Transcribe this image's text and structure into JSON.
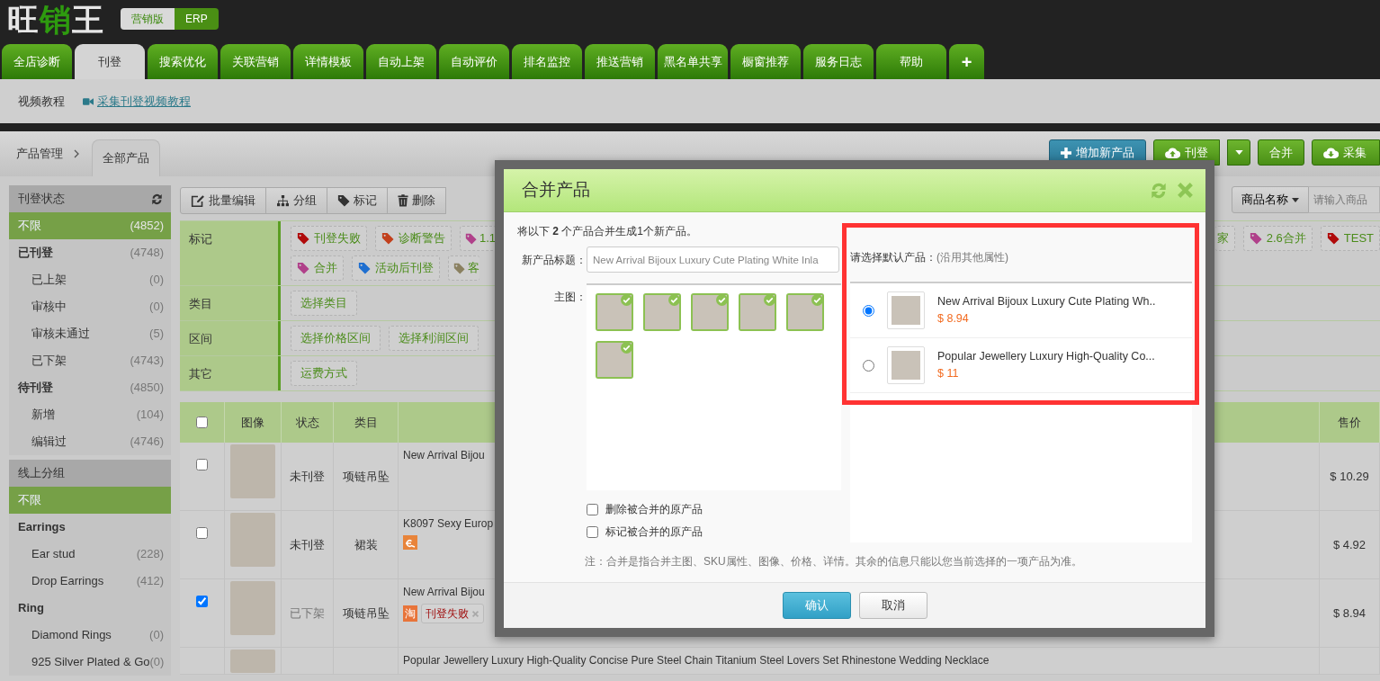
{
  "logo": [
    {
      "text": "旺",
      "color": "#e6e6e6"
    },
    {
      "text": "销",
      "color": "#2e9b0f"
    },
    {
      "text": "王",
      "color": "#e6e6e6"
    }
  ],
  "edition_switch": [
    {
      "label": "营销版",
      "selected": true
    },
    {
      "label": "ERP",
      "selected": false
    }
  ],
  "nav_tabs": [
    {
      "label": "全店诊断",
      "selected": false
    },
    {
      "label": "刊登",
      "selected": true
    },
    {
      "label": "搜索优化",
      "selected": false
    },
    {
      "label": "关联营销",
      "selected": false
    },
    {
      "label": "详情模板",
      "selected": false
    },
    {
      "label": "自动上架",
      "selected": false
    },
    {
      "label": "自动评价",
      "selected": false
    },
    {
      "label": "排名监控",
      "selected": false
    },
    {
      "label": "推送营销",
      "selected": false
    },
    {
      "label": "黑名单共享",
      "selected": false
    },
    {
      "label": "橱窗推荐",
      "selected": false
    },
    {
      "label": "服务日志",
      "selected": false
    },
    {
      "label": "帮助",
      "selected": false
    },
    {
      "label": "+",
      "selected": false
    }
  ],
  "sub_links": [
    {
      "label": "视频教程",
      "kind": "text"
    },
    {
      "label": "采集刊登视频教程",
      "kind": "video"
    }
  ],
  "breadcrumb": {
    "parent": "产品管理",
    "current": "全部产品"
  },
  "action_buttons": [
    {
      "label": "增加新产品",
      "kind": "add"
    },
    {
      "label": "刊登",
      "kind": "upload"
    },
    {
      "label": "合并",
      "kind": "plain"
    },
    {
      "label": "采集",
      "kind": "download"
    }
  ],
  "sidebar": [
    {
      "title": "刊登状态",
      "items": [
        {
          "label": "不限",
          "count": "(4852)",
          "selected": true
        },
        {
          "label": "已刊登",
          "count": "(4748)",
          "selected": false,
          "children": [
            {
              "label": "已上架",
              "count": "(0)",
              "selected": false
            },
            {
              "label": "审核中",
              "count": "(0)",
              "selected": false
            },
            {
              "label": "审核未通过",
              "count": "(5)",
              "selected": false
            },
            {
              "label": "已下架",
              "count": "(4743)",
              "selected": false
            }
          ]
        },
        {
          "label": "待刊登",
          "count": "(4850)",
          "selected": false,
          "children": [
            {
              "label": "新增",
              "count": "(104)",
              "selected": false
            },
            {
              "label": "编辑过",
              "count": "(4746)",
              "selected": false
            }
          ]
        }
      ]
    },
    {
      "title": "线上分组",
      "items": [
        {
          "label": "不限",
          "selected": true
        },
        {
          "label": "Earrings",
          "selected": false,
          "children": [
            {
              "label": "Ear stud",
              "count": "(228)",
              "selected": false
            },
            {
              "label": "Drop Earrings",
              "count": "(412)",
              "selected": false
            }
          ]
        },
        {
          "label": "Ring",
          "selected": false,
          "children": [
            {
              "label": "Diamond Rings",
              "count": "(0)",
              "selected": false
            },
            {
              "label": "925 Silver Plated & Go",
              "count": "(0)",
              "selected": false
            }
          ]
        }
      ]
    }
  ],
  "toolbar": [
    {
      "label": "批量编辑",
      "kind": "edit"
    },
    {
      "label": "分组",
      "kind": "group"
    },
    {
      "label": "标记",
      "kind": "tag"
    },
    {
      "label": "删除",
      "kind": "delete"
    }
  ],
  "search": {
    "field": "商品名称",
    "placeholder": "请输入商品"
  },
  "filters": [
    {
      "label": "标记",
      "lines": [
        {
          "left": [
            {
              "text": "刊登失败",
              "color": "#b00b0b"
            },
            {
              "text": "诊断警告",
              "color": "#c2401c"
            },
            {
              "text": "1.1",
              "color": "#b0408a"
            }
          ],
          "right": [
            {
              "text": "家"
            },
            {
              "text": "2.6合并",
              "color": "#b0408a"
            },
            {
              "text": "TEST",
              "color": "#b00b0b"
            }
          ]
        },
        {
          "left": [
            {
              "text": "合并",
              "color": "#b0408a"
            },
            {
              "text": "活动后刊登",
              "color": "#1f6fd0"
            },
            {
              "text": "客",
              "color": "#8a8060"
            }
          ]
        }
      ]
    },
    {
      "label": "类目",
      "lines": [
        {
          "left": [
            {
              "text": "选择类目"
            }
          ]
        }
      ]
    },
    {
      "label": "区间",
      "lines": [
        {
          "left": [
            {
              "text": "选择价格区间"
            },
            {
              "text": "选择利润区间"
            }
          ]
        }
      ]
    },
    {
      "label": "其它",
      "lines": [
        {
          "left": [
            {
              "text": "运费方式"
            }
          ]
        }
      ]
    }
  ],
  "table": {
    "all_checked": false,
    "columns": [
      "图像",
      "状态",
      "类目",
      "售价"
    ],
    "rows": [
      {
        "checked": false,
        "status": "未刊登",
        "delisted": false,
        "category": "项链吊坠",
        "title": "New Arrival Bijou",
        "price": "$ 10.29"
      },
      {
        "checked": false,
        "status": "未刊登",
        "delisted": false,
        "category": "裙装",
        "title": "K8097 Sexy Europ",
        "shop_badge": {
          "kind": "icon"
        },
        "price": "$ 4.92"
      },
      {
        "checked": true,
        "status": "已下架",
        "delisted": true,
        "category": "项链吊坠",
        "title": "New Arrival Bijou",
        "shop_badge": {
          "kind": "text",
          "text": "淘"
        },
        "tags": [
          "刊登失败"
        ],
        "price": "$ 8.94"
      },
      {
        "title": "Popular Jewellery Luxury High-Quality Concise Pure Steel Chain Titanium Steel Lovers Set Rhinestone Wedding Necklace"
      }
    ]
  },
  "dialog": {
    "title": "合并产品",
    "intro": "将以下 **2** 个产品合并生成1个新产品。",
    "title_label": "新产品标题：",
    "title_value": "New Arrival Bijoux Luxury Cute Plating White Inla",
    "images_label": "主图：",
    "images": [
      {
        "selected": true
      },
      {
        "selected": true
      },
      {
        "selected": true
      },
      {
        "selected": true
      },
      {
        "selected": true
      },
      {
        "selected": true
      }
    ],
    "options": [
      {
        "label": "删除被合并的原产品",
        "checked": false
      },
      {
        "label": "标记被合并的原产品",
        "checked": false
      }
    ],
    "note": "注：合并是指合并主图、SKU属性、图像、价格、详情。其余的信息只能以您当前选择的一项产品为准。",
    "default_label": "请选择默认产品：",
    "default_hint": "(沿用其他属性)",
    "products": [
      {
        "title": "New Arrival Bijoux Luxury Cute Plating Wh..",
        "price": "$ 8.94",
        "selected": true
      },
      {
        "title": "Popular Jewellery Luxury High-Quality Co...",
        "price": "$ 11",
        "selected": false
      }
    ],
    "buttons": [
      {
        "label": "确认",
        "kind": "primary"
      },
      {
        "label": "取消",
        "kind": "secondary"
      }
    ]
  }
}
